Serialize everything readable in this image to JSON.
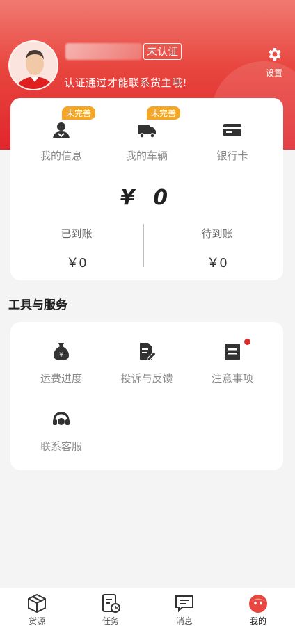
{
  "header": {
    "cert_status": "未认证",
    "cert_tip": "认证通过才能联系货主哦!",
    "settings_label": "设置"
  },
  "quick_actions": [
    {
      "label": "我的信息",
      "badge": "未完善",
      "icon": "person-icon"
    },
    {
      "label": "我的车辆",
      "badge": "未完善",
      "icon": "truck-icon"
    },
    {
      "label": "银行卡",
      "badge": "",
      "icon": "bank-card-icon"
    }
  ],
  "balance": {
    "total": "¥ 0",
    "received_label": "已到账",
    "received_value": "￥0",
    "pending_label": "待到账",
    "pending_value": "￥0"
  },
  "tools": {
    "title": "工具与服务",
    "items": [
      {
        "label": "运费进度",
        "icon": "money-bag-icon",
        "dot": false
      },
      {
        "label": "投诉与反馈",
        "icon": "document-edit-icon",
        "dot": false
      },
      {
        "label": "注意事项",
        "icon": "notice-icon",
        "dot": true
      },
      {
        "label": "联系客服",
        "icon": "headset-icon",
        "dot": false
      }
    ]
  },
  "tabbar": [
    {
      "label": "货源",
      "icon": "box-icon",
      "active": false
    },
    {
      "label": "任务",
      "icon": "task-icon",
      "active": false
    },
    {
      "label": "消息",
      "icon": "message-icon",
      "active": false
    },
    {
      "label": "我的",
      "icon": "profile-face-icon",
      "active": true
    }
  ],
  "colors": {
    "brand": "#e0262c",
    "badge": "#f5a623",
    "dot": "#e02b2b"
  }
}
